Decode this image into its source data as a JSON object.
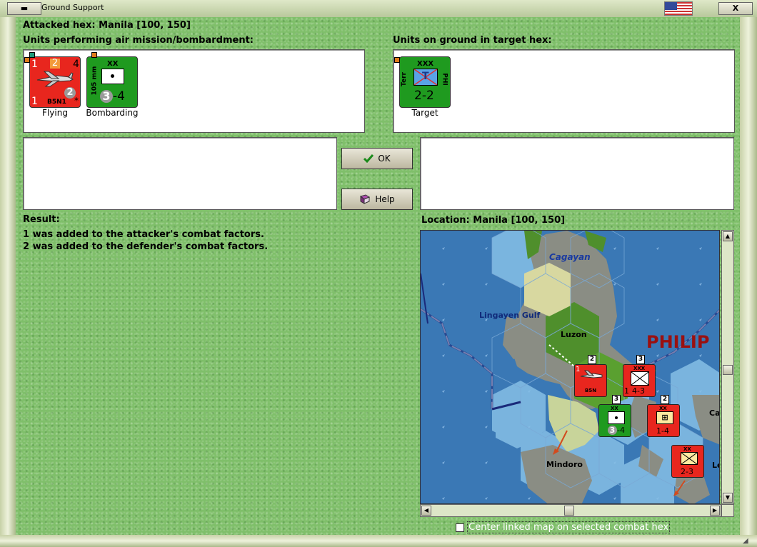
{
  "window": {
    "title": "Ground Support",
    "min_glyph": "▬",
    "close_glyph": "X",
    "flag_icon": "us-flag-icon"
  },
  "header": {
    "attacked_hex": "Attacked hex: Manila  [100, 150]"
  },
  "attackers": {
    "label": "Units performing air mission/bombardment:",
    "units": [
      {
        "type": "air",
        "color": "#e8261e",
        "top_left": "1",
        "top_badge": "2",
        "top_right": "4",
        "circle": "2",
        "bottom_left": "1",
        "name": "B5N1",
        "star": "*",
        "caption": "Flying"
      },
      {
        "type": "artillery",
        "color": "#1f9a1f",
        "size_mark": "XX",
        "side_label": "105 mm",
        "circle": "3",
        "factor": "-4",
        "caption": "Bombarding"
      }
    ]
  },
  "defenders": {
    "label": "Units on ground in target hex:",
    "units": [
      {
        "type": "territorial",
        "color": "#1f9a1f",
        "size_mark": "XXX",
        "left_label": "Terr",
        "right_label": "PHI",
        "center": "T",
        "factor": "2-2",
        "caption": "Target"
      }
    ]
  },
  "buttons": {
    "ok": "OK",
    "help": "Help"
  },
  "result": {
    "label": "Result:",
    "lines": [
      "1 was added to the attacker's combat factors.",
      "2 was added to the defender's combat factors."
    ]
  },
  "location": {
    "label": "Location:  Manila  [100, 150]"
  },
  "map": {
    "labels": {
      "cagayan": "Cagayan",
      "lingayen": "Lingayen Gulf",
      "luzon": "Luzon",
      "philip": "PHILIP",
      "mindoro": "Mindoro",
      "ca": "Ca",
      "le": "Le"
    },
    "counters": [
      {
        "id": "air",
        "badge": "2",
        "name": "B5N",
        "stack_digit": "1",
        "color": "#e8261e"
      },
      {
        "id": "inf-xxx",
        "badge": "3",
        "size_mark": "XXX",
        "factor": "4-3",
        "stack_digit": "1",
        "color": "#e8261e"
      },
      {
        "id": "art",
        "badge": "3",
        "size_mark": "XX",
        "circle": "3",
        "factor": "-4",
        "color": "#1f9a1f"
      },
      {
        "id": "eng",
        "badge": "2",
        "size_mark": "XX",
        "factor": "1-4",
        "color": "#e8261e"
      },
      {
        "id": "inf-xx",
        "size_mark": "XX",
        "factor": "2-3",
        "color": "#e8261e"
      }
    ]
  },
  "options": {
    "center_linked_map": "Center linked map on selected combat hex",
    "checked": false
  }
}
